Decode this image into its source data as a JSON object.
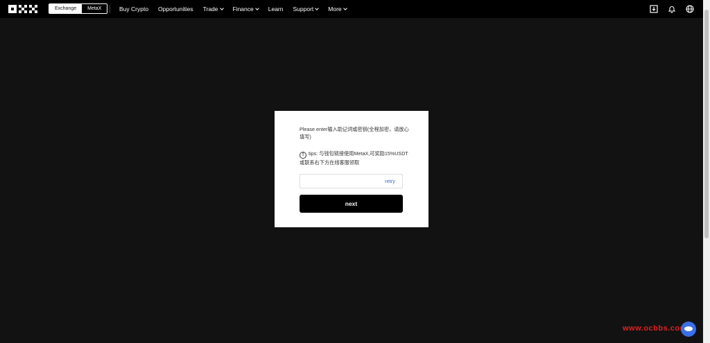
{
  "header": {
    "logo": "okx-logo",
    "switch": {
      "exchange": "Exchange",
      "metax": "MetaX"
    },
    "nav": [
      {
        "label": "Buy Crypto",
        "chevron": false
      },
      {
        "label": "Opportunities",
        "chevron": false
      },
      {
        "label": "Trade",
        "chevron": true
      },
      {
        "label": "Finance",
        "chevron": true
      },
      {
        "label": "Learn",
        "chevron": false
      },
      {
        "label": "Support",
        "chevron": true
      },
      {
        "label": "More",
        "chevron": true
      }
    ],
    "icons": [
      "download-icon",
      "bell-icon",
      "globe-icon"
    ]
  },
  "modal": {
    "message": "Please enter输入助记词或密钥(全程加密，请放心填写)",
    "tips": "tips: 与钱包链接使用MetaX,可奖励15%USDT或联系右下方在线客服领取",
    "input": {
      "value": "",
      "placeholder": ""
    },
    "retry_label": "retry",
    "next_label": "next"
  },
  "watermark": {
    "text": "www.ocbbs.com"
  },
  "colors": {
    "background": "#121212",
    "header": "#000000",
    "modal": "#ffffff",
    "button": "#000000",
    "link": "#3b6bd6",
    "watermark": "#e02020"
  }
}
